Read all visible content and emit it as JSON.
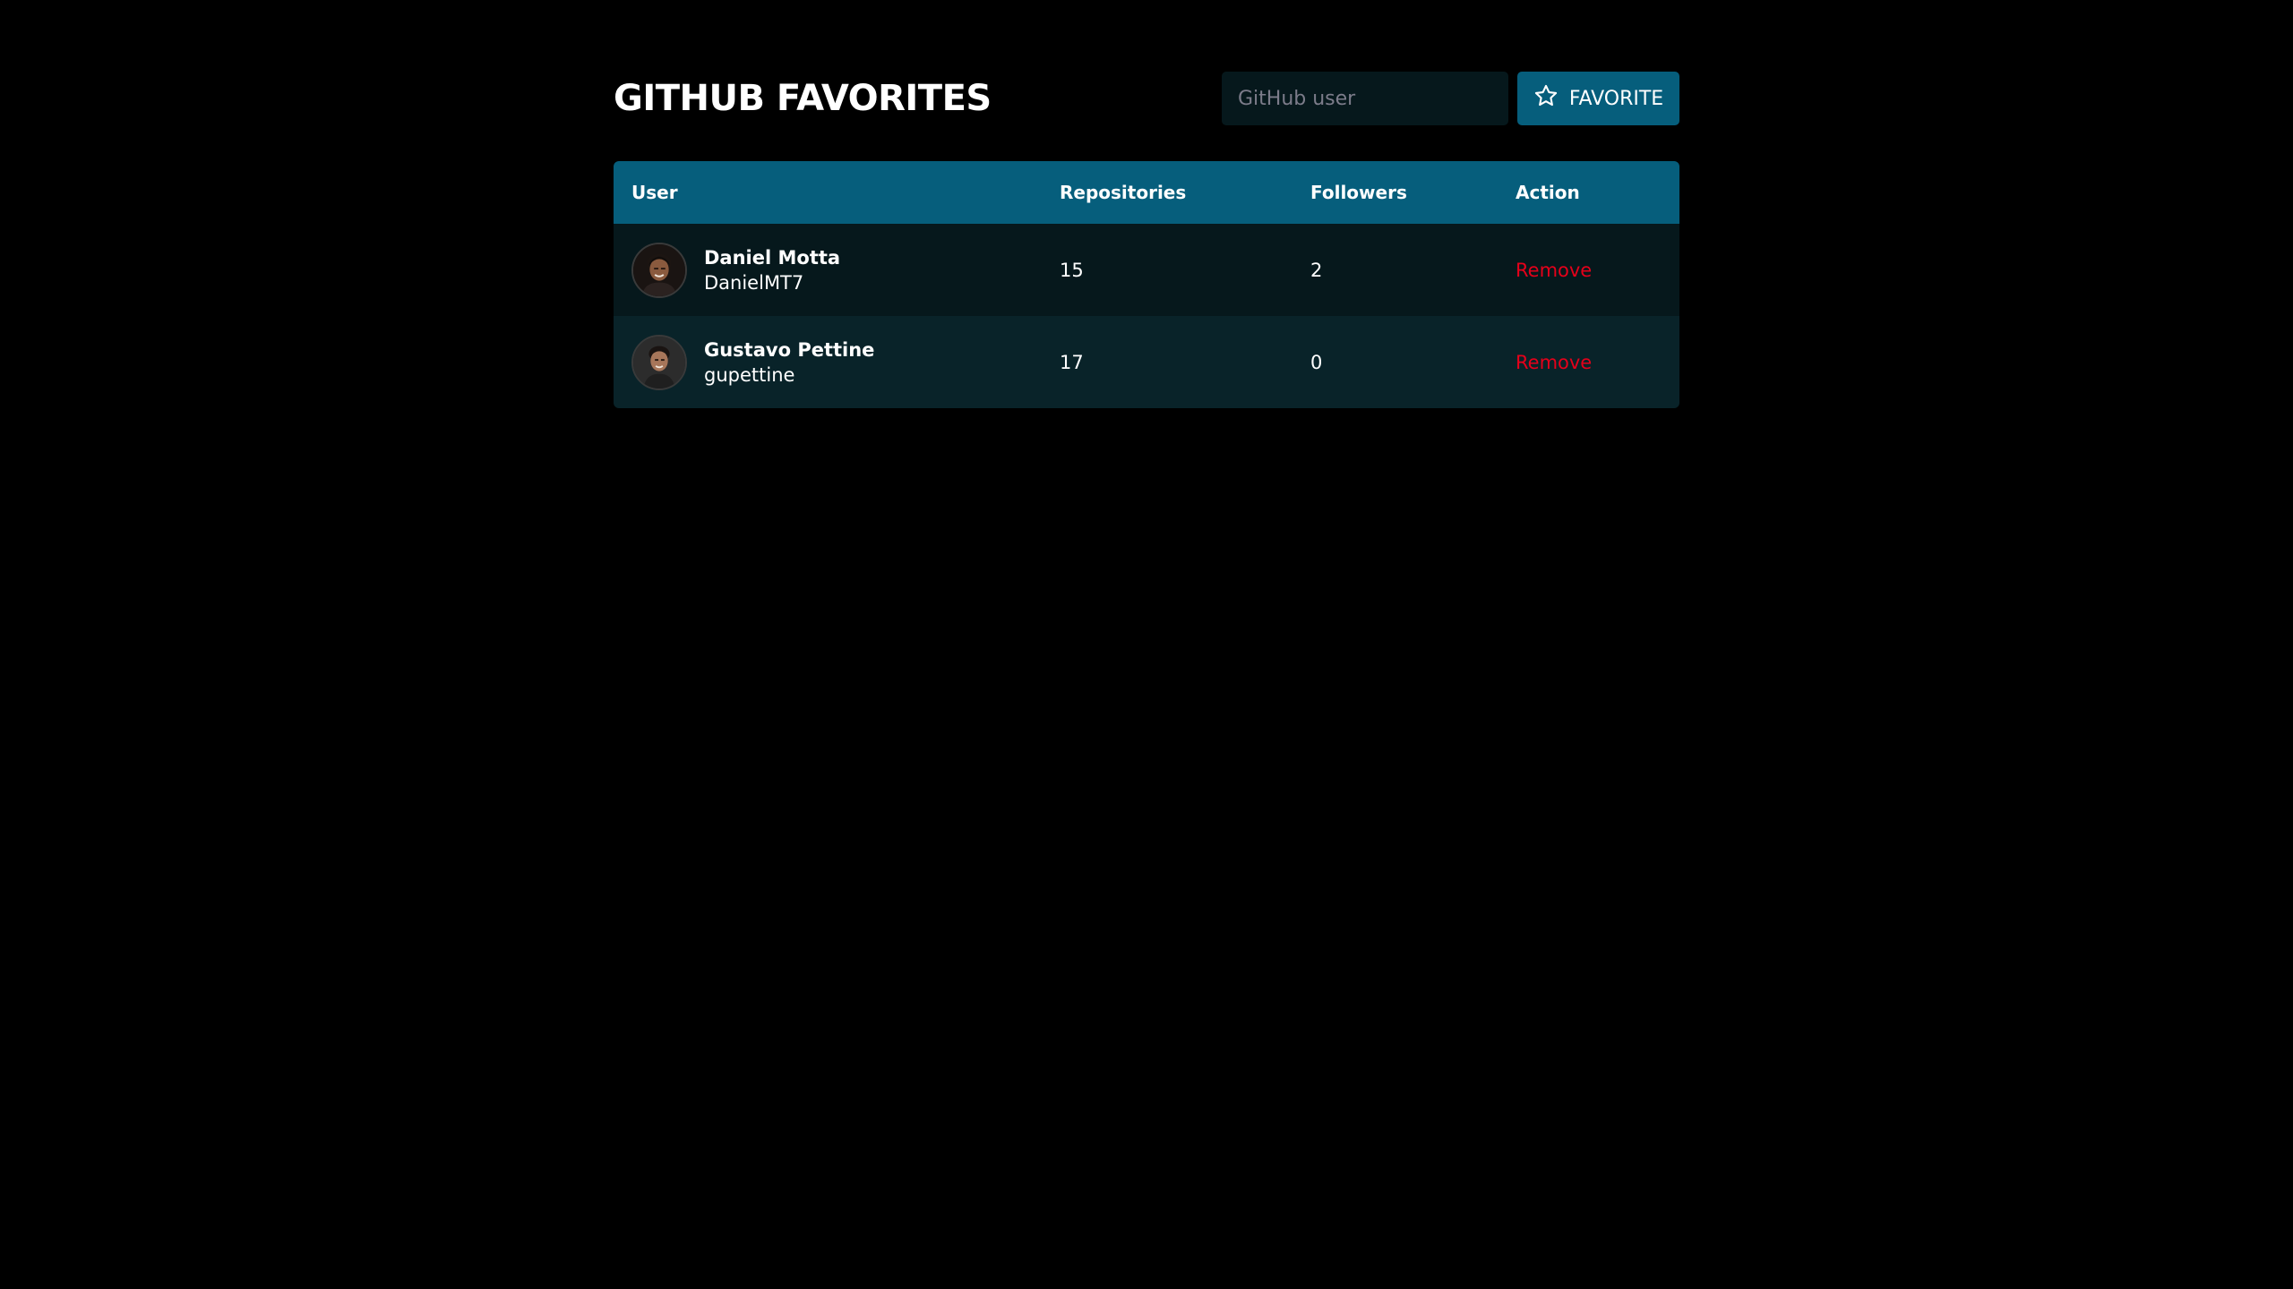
{
  "header": {
    "title": "GITHUB FAVORITES",
    "search_placeholder": "GitHub user",
    "search_value": "",
    "favorite_button_label": "FAVORITE"
  },
  "table": {
    "columns": [
      "User",
      "Repositories",
      "Followers",
      "Action"
    ],
    "rows": [
      {
        "name": "Daniel Motta",
        "login": "DanielMT7",
        "repositories": "15",
        "followers": "2",
        "action": "Remove"
      },
      {
        "name": "Gustavo Pettine",
        "login": "gupettine",
        "repositories": "17",
        "followers": "0",
        "action": "Remove"
      }
    ]
  },
  "colors": {
    "background": "#000000",
    "accent": "#065e7c",
    "row_odd": "#06181c",
    "row_even": "#092329",
    "danger": "#e5001a"
  },
  "icons": {
    "favorite_button": "star-icon"
  }
}
